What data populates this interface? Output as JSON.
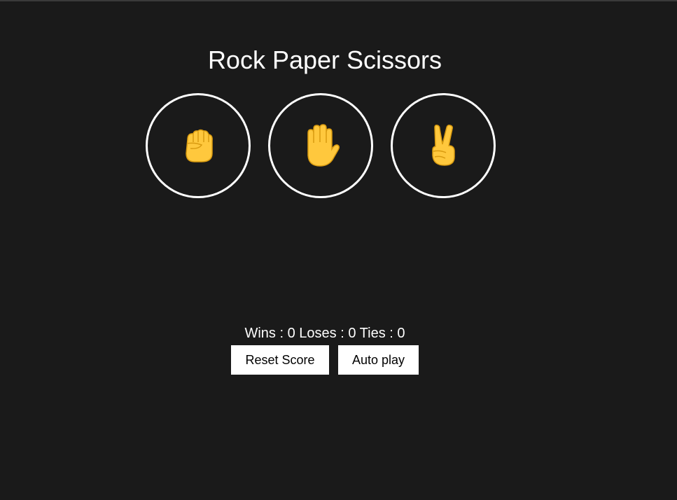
{
  "title": "Rock Paper Scissors",
  "moves": [
    {
      "name": "Rock",
      "icon": "fist-emoji-icon"
    },
    {
      "name": "Paper",
      "icon": "raised-hand-emoji-icon"
    },
    {
      "name": "Scissors",
      "icon": "victory-hand-emoji-icon"
    }
  ],
  "score": {
    "wins_label": "Wins",
    "wins": "0",
    "loses_label": "Loses",
    "loses": "0",
    "ties_label": "Ties",
    "ties": "0"
  },
  "buttons": {
    "reset": "Reset Score",
    "autoplay": "Auto play"
  },
  "colors": {
    "background": "#1a1a1a",
    "accent": "#ffffff",
    "emoji": "#ffc83d"
  }
}
